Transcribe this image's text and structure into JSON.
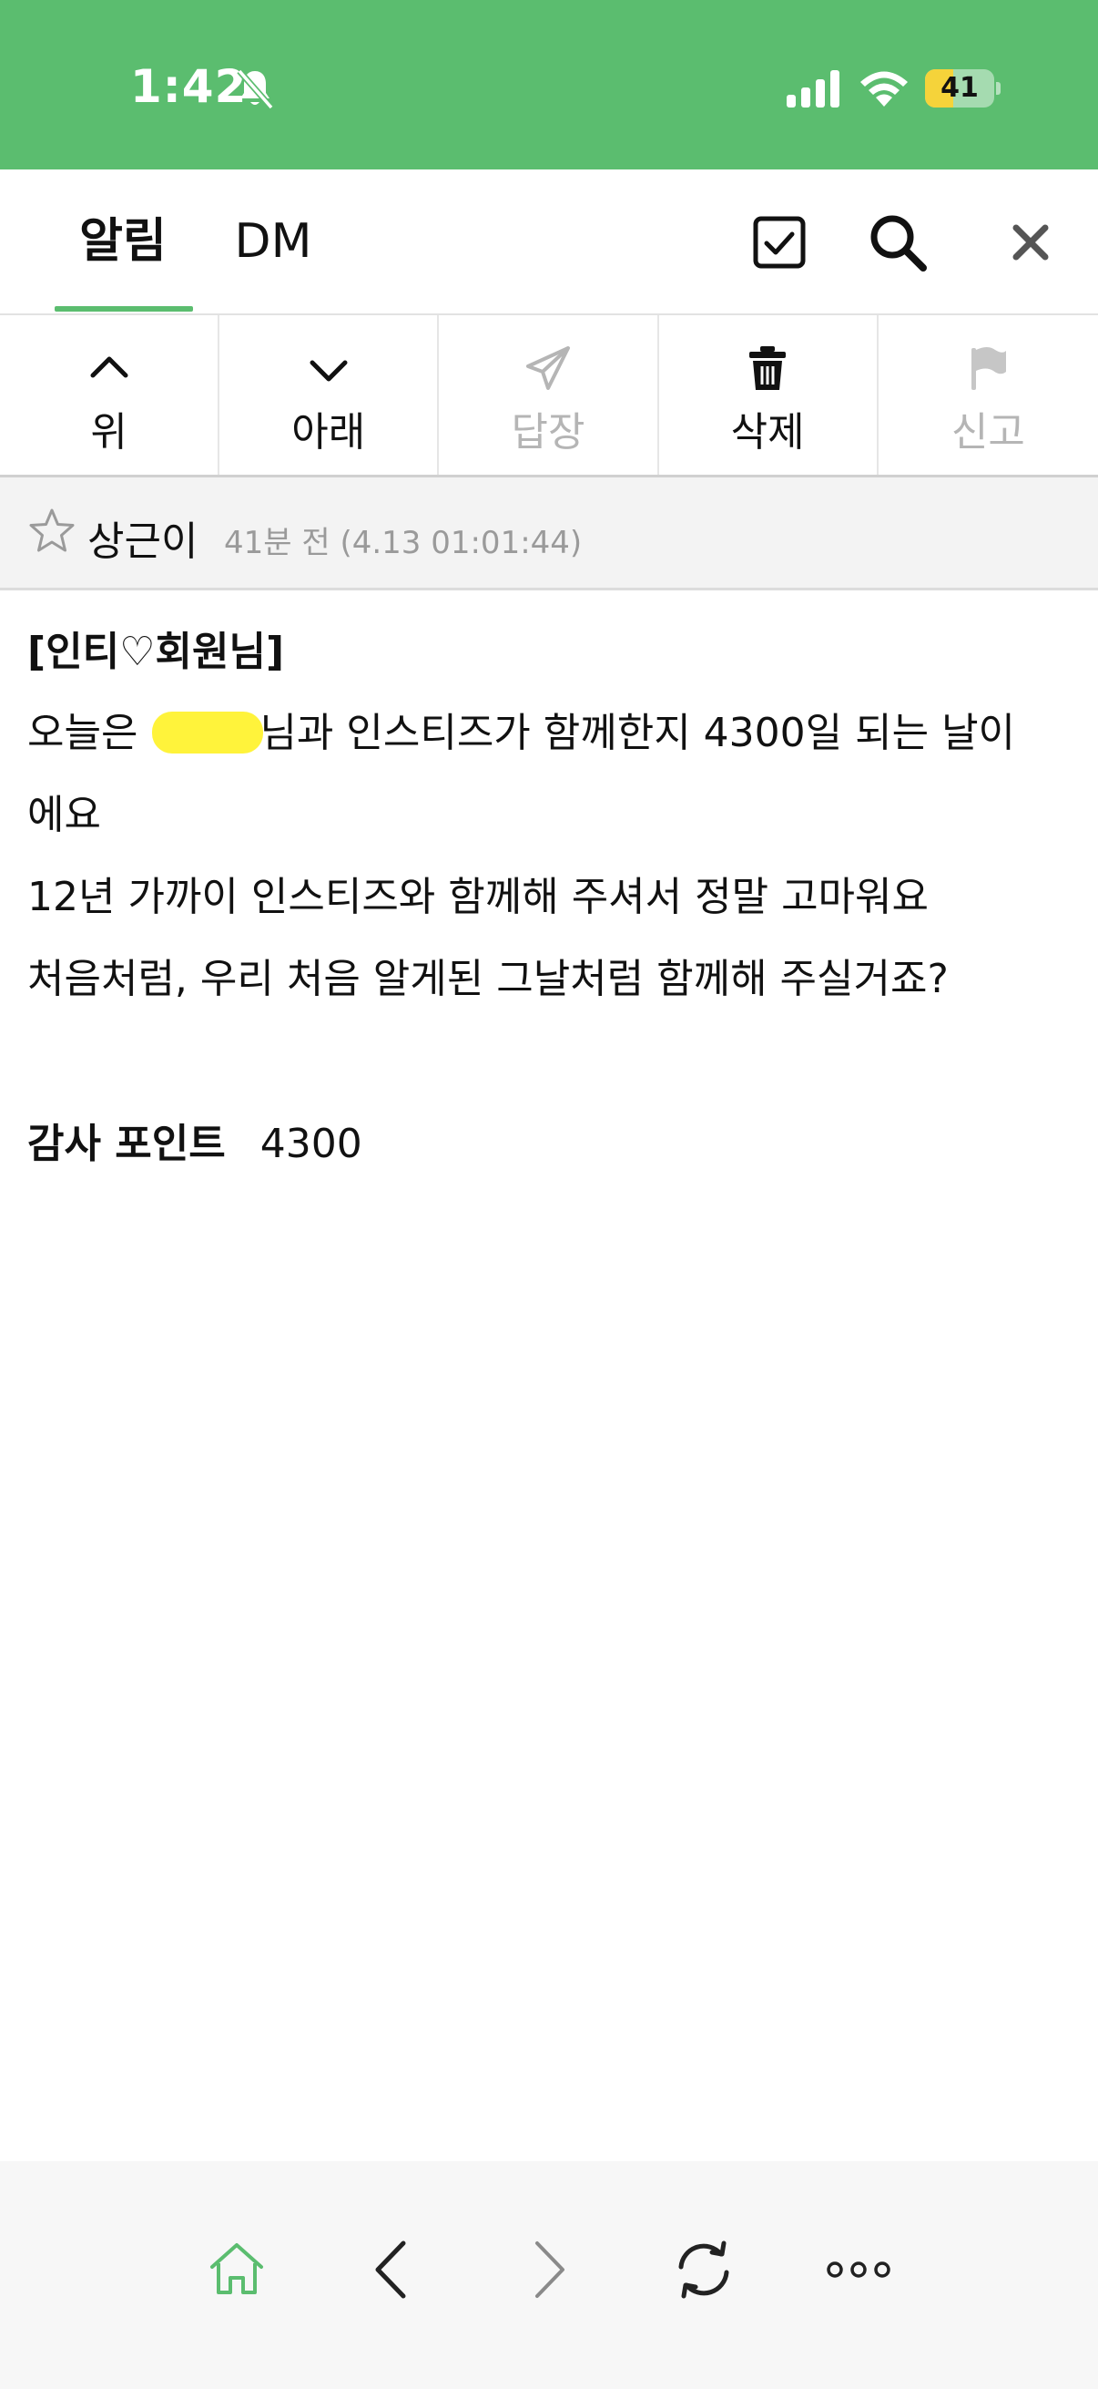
{
  "status_bar": {
    "time": "1:42",
    "battery_level": 41,
    "battery_label": "41",
    "bg_color": "#5bbd6f",
    "battery_color": "#f5d33a"
  },
  "header": {
    "tabs": [
      {
        "label": "알림",
        "active": true
      },
      {
        "label": "DM",
        "active": false
      }
    ],
    "accent_color": "#5bbd6f",
    "icons": [
      "checkbox-icon",
      "search-icon",
      "close-icon"
    ]
  },
  "toolbar": {
    "items": [
      {
        "label": "위",
        "icon": "chevron-up-icon",
        "enabled": true
      },
      {
        "label": "아래",
        "icon": "chevron-down-icon",
        "enabled": true
      },
      {
        "label": "답장",
        "icon": "paper-plane-icon",
        "enabled": false
      },
      {
        "label": "삭제",
        "icon": "trash-icon",
        "enabled": true
      },
      {
        "label": "신고",
        "icon": "flag-icon",
        "enabled": false
      }
    ]
  },
  "message": {
    "sender": "상근이",
    "timestamp": "41분 전 (4.13 01:01:44)",
    "title": "[인티♡회원님]",
    "line1_before": "오늘은 ",
    "line1_after": "님과 인스티즈가 함께한지 4300일 되는 날이",
    "line2": "에요",
    "line3": "12년 가까이 인스티즈와 함께해 주셔서 정말 고마워요",
    "line4": "처음처럼, 우리 처음 알게된 그날처럼 함께해 주실거죠?",
    "points_label": "감사 포인트",
    "points_value": "4300"
  },
  "bottom_nav": {
    "items": [
      "home-icon",
      "back-icon",
      "forward-icon",
      "refresh-icon",
      "more-icon"
    ]
  }
}
